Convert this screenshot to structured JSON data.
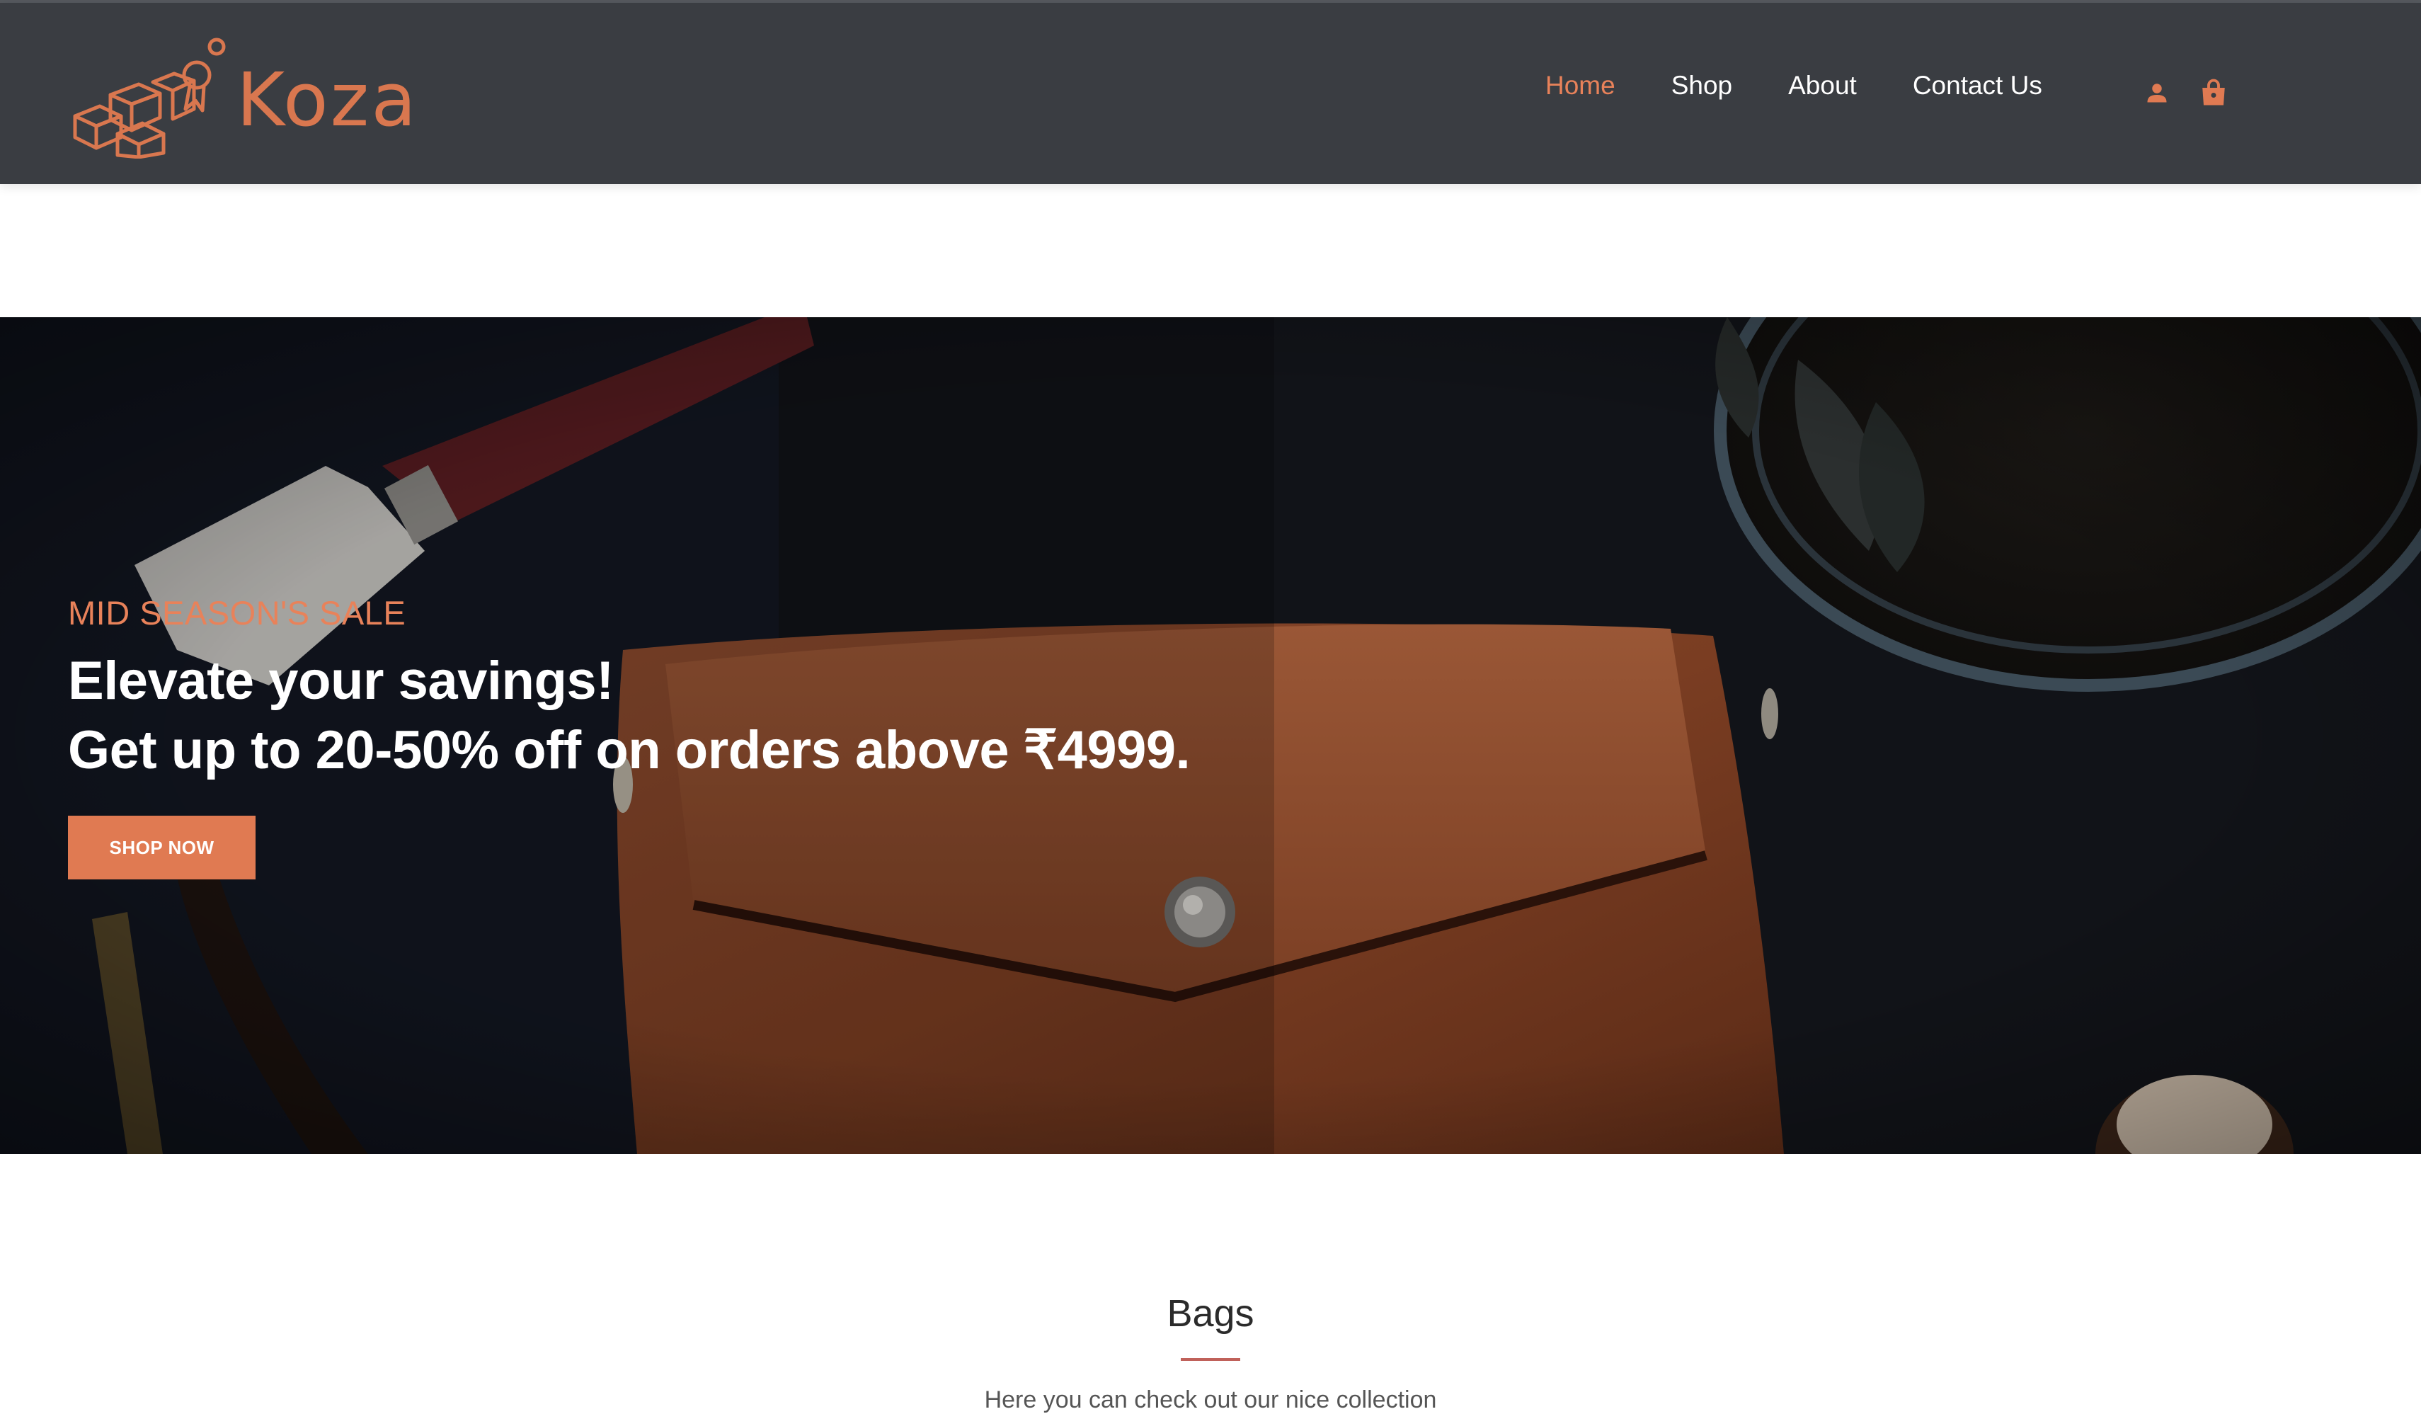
{
  "brand": {
    "name": "Koza",
    "accent": "#e07a52"
  },
  "nav": {
    "items": [
      {
        "label": "Home",
        "active": true
      },
      {
        "label": "Shop",
        "active": false
      },
      {
        "label": "About",
        "active": false
      },
      {
        "label": "Contact Us",
        "active": false
      }
    ],
    "icons": [
      "user-icon",
      "shopping-bag-icon"
    ]
  },
  "hero": {
    "subtitle": "MID SEASON'S SALE",
    "headline_line1": "Elevate your savings!",
    "headline_line2": "Get up to 20-50% off on orders above ₹4999.",
    "cta_label": "SHOP NOW"
  },
  "section": {
    "title": "Bags",
    "description": "Here you can check out our nice collection"
  },
  "colors": {
    "header_bg": "#3a3d42",
    "nav_active": "#e8825a",
    "title_rule": "#c0615a"
  }
}
